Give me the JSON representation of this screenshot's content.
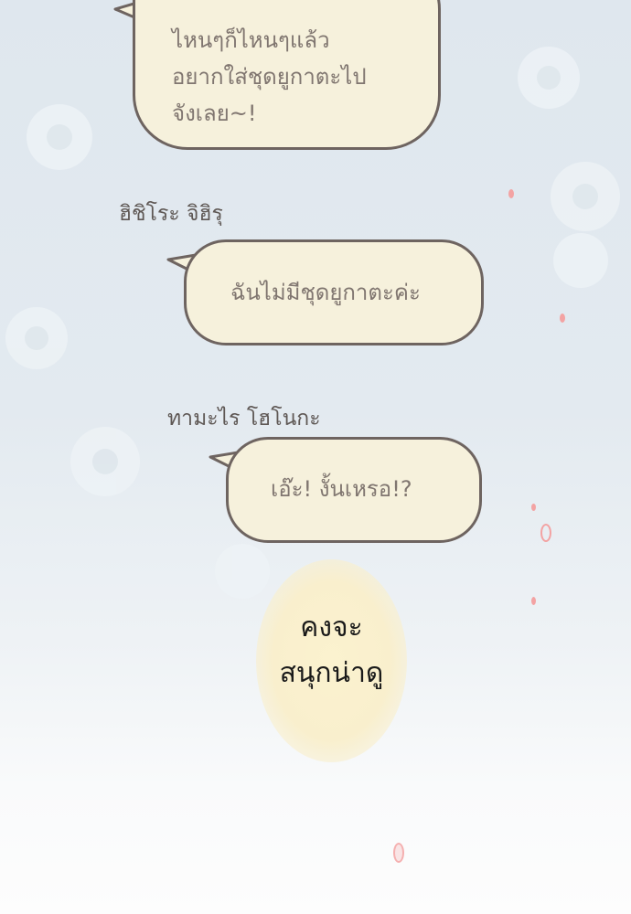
{
  "colors": {
    "bubble_fill": "#f6f1dc",
    "bubble_border": "#6e6460",
    "bubble_text": "#807670",
    "speaker_text": "#5f5855",
    "thought_glow": "#f9efcd",
    "sparkle": "#f08a8a"
  },
  "bubbles": [
    {
      "text": "ไหนๆก็ไหนๆแล้ว\nอยากใส่ชุดยูกาตะไป\nจังเลย~!"
    },
    {
      "speaker": "ฮิชิโระ จิฮิรุ",
      "text": "ฉันไม่มีชุดยูกาตะค่ะ"
    },
    {
      "speaker": "ทามะไร โฮโนกะ",
      "text": "เอ๊ะ! งั้นเหรอ!?"
    }
  ],
  "thought": {
    "text": "คงจะ\nสนุกน่าดู"
  }
}
